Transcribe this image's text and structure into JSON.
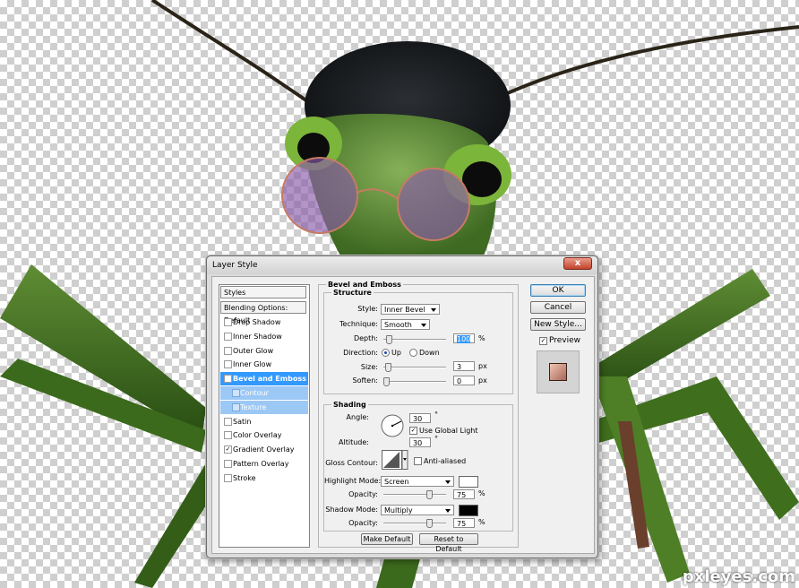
{
  "dialog": {
    "title": "Layer Style",
    "close": "x"
  },
  "left_panel": {
    "header": "Styles",
    "blending": "Blending Options: Default",
    "items": [
      {
        "label": "Drop Shadow",
        "checked": false
      },
      {
        "label": "Inner Shadow",
        "checked": false
      },
      {
        "label": "Outer Glow",
        "checked": false
      },
      {
        "label": "Inner Glow",
        "checked": false
      },
      {
        "label": "Bevel and Emboss",
        "checked": true
      },
      {
        "label": "Contour",
        "checked": false
      },
      {
        "label": "Texture",
        "checked": false
      },
      {
        "label": "Satin",
        "checked": false
      },
      {
        "label": "Color Overlay",
        "checked": false
      },
      {
        "label": "Gradient Overlay",
        "checked": true
      },
      {
        "label": "Pattern Overlay",
        "checked": false
      },
      {
        "label": "Stroke",
        "checked": false
      }
    ],
    "check_glyph": "✓"
  },
  "bevel": {
    "title": "Bevel and Emboss",
    "structure": {
      "title": "Structure",
      "style_label": "Style:",
      "style_value": "Inner Bevel",
      "technique_label": "Technique:",
      "technique_value": "Smooth",
      "depth_label": "Depth:",
      "depth_value": "100",
      "depth_unit": "%",
      "depth_level": 0.05,
      "direction_label": "Direction:",
      "up_label": "Up",
      "down_label": "Down",
      "size_label": "Size:",
      "size_value": "3",
      "size_unit": "px",
      "size_level": 0.03,
      "soften_label": "Soften:",
      "soften_value": "0",
      "soften_unit": "px",
      "soften_level": 0.0
    },
    "shading": {
      "title": "Shading",
      "angle_label": "Angle:",
      "angle_value": "30",
      "angle_unit": "°",
      "global_light": "Use Global Light",
      "altitude_label": "Altitude:",
      "altitude_value": "30",
      "altitude_unit": "°",
      "gloss_label": "Gloss Contour:",
      "anti_aliased": "Anti-aliased",
      "highlight_mode_label": "Highlight Mode:",
      "highlight_mode_value": "Screen",
      "highlight_color": "#ffffff",
      "highlight_opacity_label": "Opacity:",
      "highlight_opacity_value": "75",
      "highlight_opacity_unit": "%",
      "highlight_opacity_level": 0.75,
      "shadow_mode_label": "Shadow Mode:",
      "shadow_mode_value": "Multiply",
      "shadow_color": "#000000",
      "shadow_opacity_label": "Opacity:",
      "shadow_opacity_value": "75",
      "shadow_opacity_unit": "%",
      "shadow_opacity_level": 0.75
    },
    "make_default": "Make Default",
    "reset_default": "Reset to Default"
  },
  "right": {
    "ok": "OK",
    "cancel": "Cancel",
    "new_style": "New Style...",
    "preview": "Preview"
  },
  "watermark": "pxleyes.com"
}
